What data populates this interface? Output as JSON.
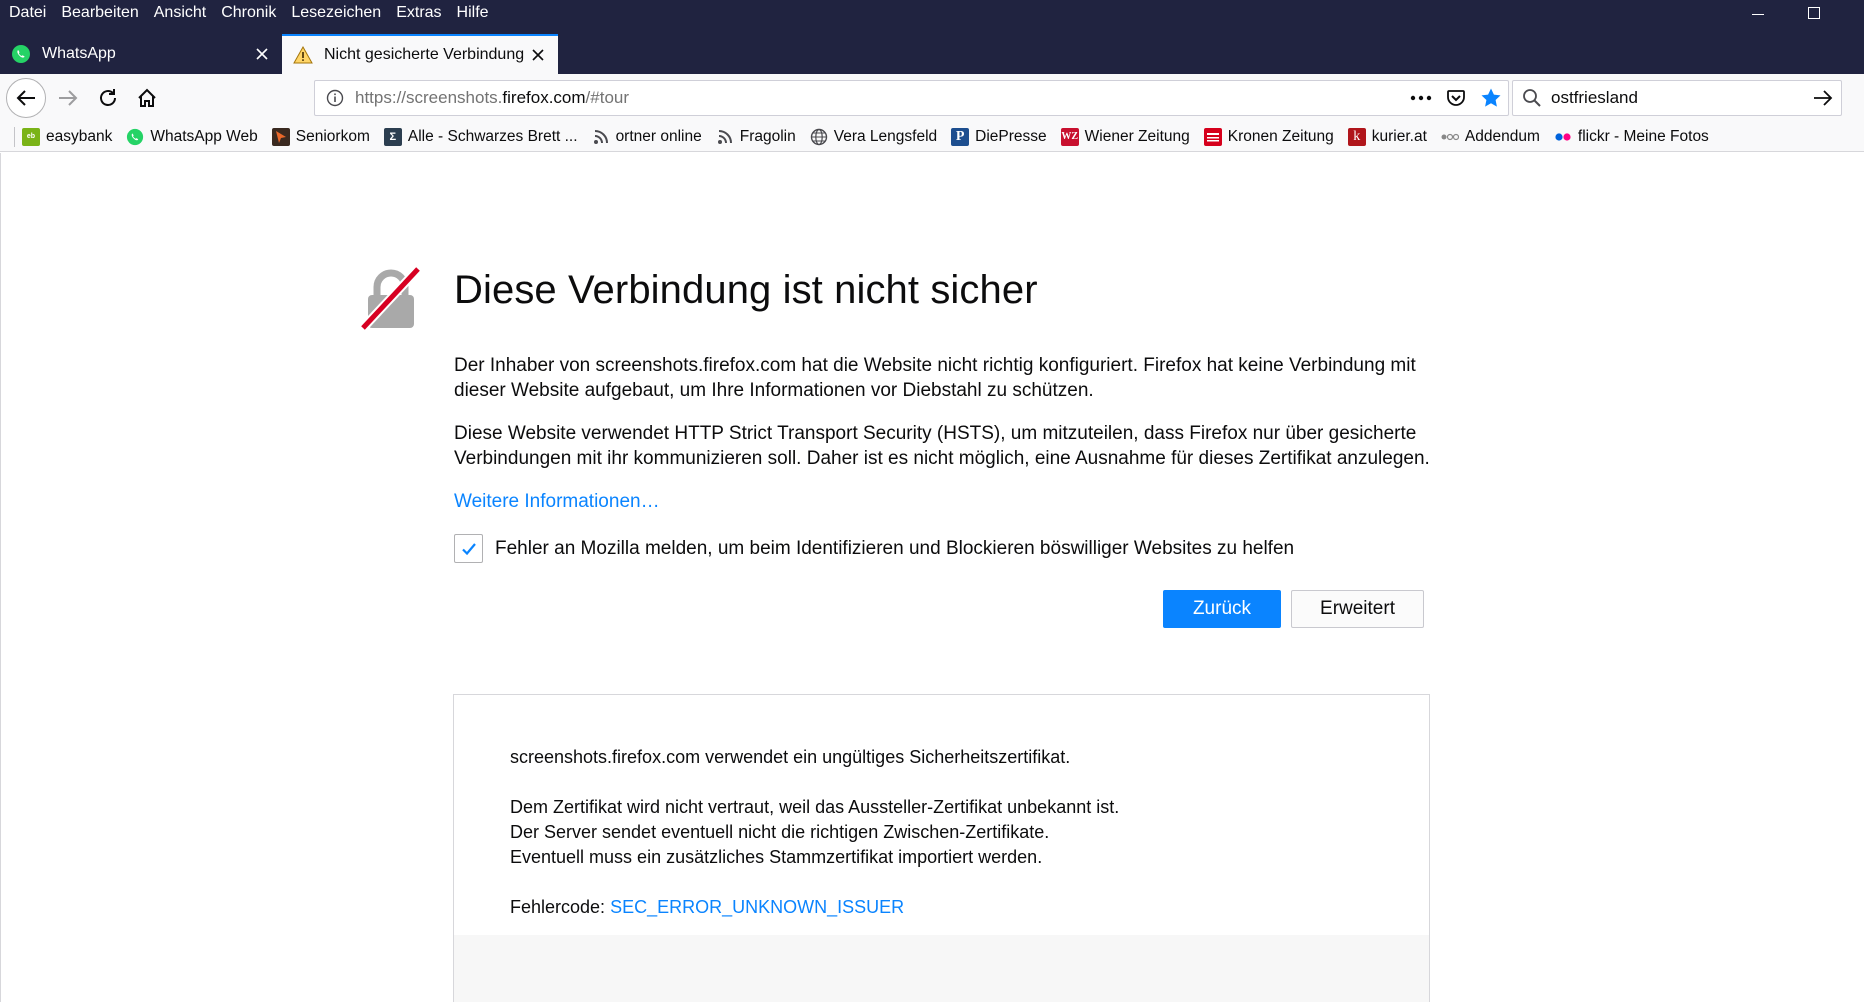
{
  "menu": [
    "Datei",
    "Bearbeiten",
    "Ansicht",
    "Chronik",
    "Lesezeichen",
    "Extras",
    "Hilfe"
  ],
  "tabs": [
    {
      "label": "WhatsApp",
      "icon": "whatsapp-icon"
    },
    {
      "label": "Nicht gesicherte Verbindung",
      "icon": "warning-icon"
    }
  ],
  "nav": {
    "url_prefix": "https://screenshots.",
    "url_host": "firefox.com",
    "url_suffix": "/#tour",
    "search_value": "ostfriesland"
  },
  "bookmarks": [
    {
      "label": "easybank",
      "icon": "easybank-icon",
      "color": "#7ab317"
    },
    {
      "label": "WhatsApp Web",
      "icon": "whatsapp-icon",
      "color": "#25d366"
    },
    {
      "label": "Seniorkom",
      "icon": "seniorkom-icon",
      "color": "#e8682a"
    },
    {
      "label": "Alle - Schwarzes Brett ...",
      "icon": "board-icon",
      "color": "#2c3e50"
    },
    {
      "label": "ortner online",
      "icon": "rss-icon",
      "color": "#555555"
    },
    {
      "label": "Fragolin",
      "icon": "rss-icon",
      "color": "#555555"
    },
    {
      "label": "Vera Lengsfeld",
      "icon": "globe-icon",
      "color": "#555555"
    },
    {
      "label": "DiePresse",
      "icon": "diepresse-icon",
      "color": "#1d4e8f"
    },
    {
      "label": "Wiener Zeitung",
      "icon": "wienerzeitung-icon",
      "color": "#c8102e"
    },
    {
      "label": "Kronen Zeitung",
      "icon": "krone-icon",
      "color": "#d6001c"
    },
    {
      "label": "kurier.at",
      "icon": "kurier-icon",
      "color": "#b0151b"
    },
    {
      "label": "Addendum",
      "icon": "addendum-icon",
      "color": "#888888"
    },
    {
      "label": "flickr - Meine Fotos",
      "icon": "flickr-icon",
      "color": "#ff0084"
    }
  ],
  "error": {
    "title": "Diese Verbindung ist nicht sicher",
    "p1": "Der Inhaber von screenshots.firefox.com hat die Website nicht richtig konfiguriert. Firefox hat keine Verbindung mit dieser Website aufgebaut, um Ihre Informationen vor Diebstahl zu schützen.",
    "p2": "Diese Website verwendet HTTP Strict Transport Security (HSTS), um mitzuteilen, dass Firefox nur über gesicherte Verbindungen mit ihr kommunizieren soll. Daher ist es nicht möglich, eine Ausnahme für dieses Zertifikat anzulegen.",
    "learn_more": "Weitere Informationen…",
    "report_label": "Fehler an Mozilla melden, um beim Identifizieren und Blockieren böswilliger Websites zu helfen",
    "report_checked": true,
    "back_button": "Zurück",
    "advanced_button": "Erweitert"
  },
  "details": {
    "line1": "screenshots.firefox.com verwendet ein ungültiges Sicherheitszertifikat.",
    "line2": "Dem Zertifikat wird nicht vertraut, weil das Aussteller-Zertifikat unbekannt ist.",
    "line3": "Der Server sendet eventuell nicht die richtigen Zwischen-Zertifikate.",
    "line4": "Eventuell muss ein zusätzliches Stammzertifikat importiert werden.",
    "code_label": "Fehlercode: ",
    "code": "SEC_ERROR_UNKNOWN_ISSUER"
  },
  "colors": {
    "accent": "#0a84ff",
    "chrome_dark": "#202340",
    "lock_strike": "#d70022"
  }
}
